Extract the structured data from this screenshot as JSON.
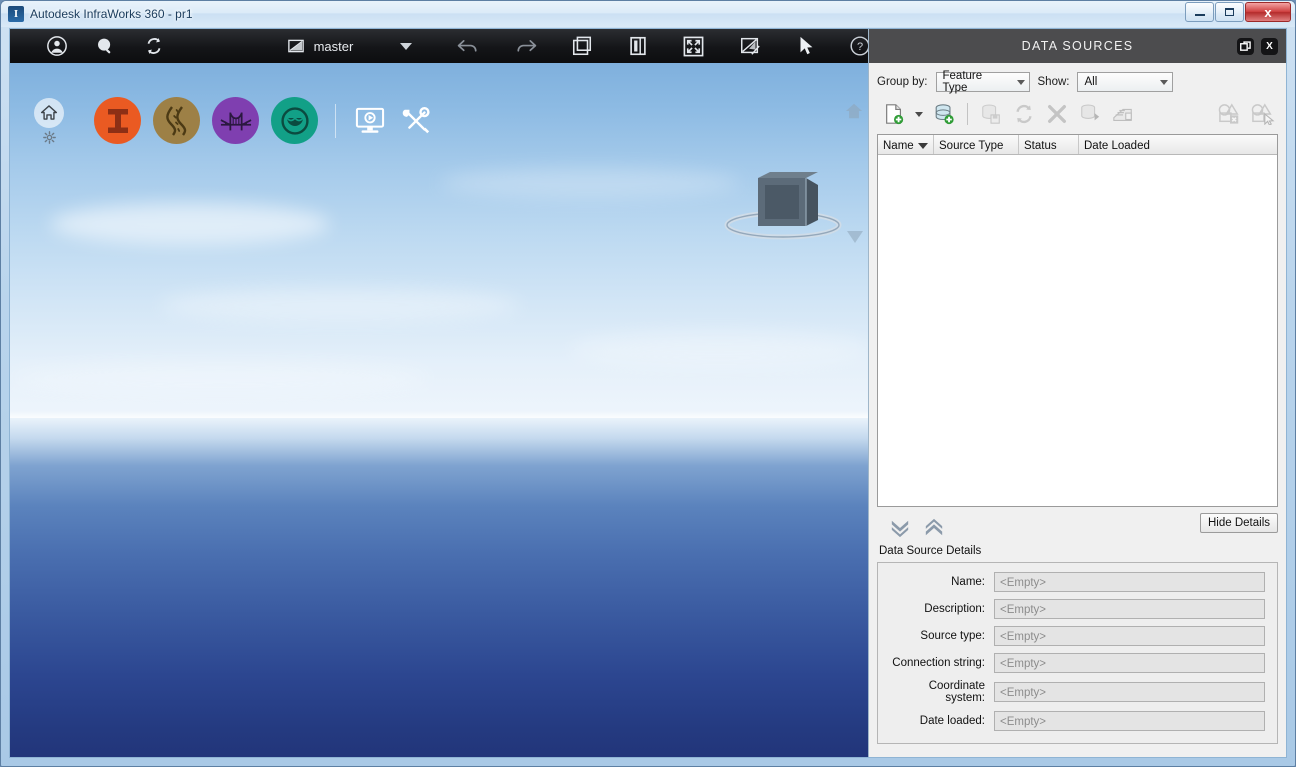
{
  "window": {
    "title": "Autodesk InfraWorks 360 - pr1",
    "app_icon": "infraworks-logo-icon",
    "buttons": {
      "minimize": "minimize-icon",
      "maximize": "maximize-icon",
      "close": "x"
    }
  },
  "app_toolbar": {
    "items": [
      {
        "name": "account-icon",
        "title": "Account"
      },
      {
        "name": "search-icon",
        "title": "Search"
      },
      {
        "name": "sync-icon",
        "title": "Sync"
      }
    ],
    "model_chip": {
      "icon": "model-icon",
      "label": "master",
      "caret": "chevron-down-icon"
    },
    "right_items": [
      {
        "name": "undo-icon",
        "title": "Undo"
      },
      {
        "name": "redo-icon",
        "title": "Redo"
      },
      {
        "name": "bookmarks-icon",
        "title": "Bookmarks"
      },
      {
        "name": "panels-icon",
        "title": "Panels"
      },
      {
        "name": "fullscreen-icon",
        "title": "Full Screen"
      },
      {
        "name": "measure-icon",
        "title": "Measure"
      },
      {
        "name": "select-cursor-icon",
        "title": "Select"
      },
      {
        "name": "help-icon",
        "title": "Help"
      }
    ]
  },
  "viewport": {
    "home_button": "home-icon",
    "settings_button": "gear-icon",
    "feature_buttons": [
      {
        "name": "intersection-tool",
        "color": "#ea5a22",
        "glyph": "i-beam-icon"
      },
      {
        "name": "road-tool",
        "color": "#9d8046",
        "glyph": "road-icon"
      },
      {
        "name": "bridge-tool",
        "color": "#7f3fb0",
        "glyph": "bridge-icon"
      },
      {
        "name": "water-tool",
        "color": "#12a087",
        "glyph": "water-icon"
      }
    ],
    "flat_buttons": [
      {
        "name": "presentation-icon",
        "title": "Presentation"
      },
      {
        "name": "tools-icon",
        "title": "Tools"
      }
    ],
    "viewcube": "viewcube-navigation-widget",
    "nav_home_small": "home-icon",
    "nav_chevron": "chevron-down-icon"
  },
  "panel": {
    "title": "DATA SOURCES",
    "header_buttons": [
      {
        "name": "undock-panel-button",
        "glyph": "⧉"
      },
      {
        "name": "close-panel-button",
        "glyph": "X"
      }
    ],
    "filters": {
      "group_by_label": "Group by:",
      "group_by_value": "Feature Type",
      "show_label": "Show:",
      "show_value": "All"
    },
    "toolbar": [
      {
        "name": "add-file-data-source-button",
        "enabled": true
      },
      {
        "name": "add-file-dropdown-button",
        "enabled": true
      },
      {
        "name": "connect-database-button",
        "enabled": true
      },
      {
        "name": "save-data-source-button",
        "enabled": false
      },
      {
        "name": "refresh-data-source-button",
        "enabled": false
      },
      {
        "name": "delete-data-source-button",
        "enabled": false
      },
      {
        "name": "import-data-source-button",
        "enabled": false
      },
      {
        "name": "configure-data-source-button",
        "enabled": false
      },
      {
        "name": "close-all-features-button",
        "enabled": false
      },
      {
        "name": "select-all-features-button",
        "enabled": false
      }
    ],
    "grid": {
      "columns": [
        "Name",
        "Source Type",
        "Status",
        "Date Loaded"
      ],
      "rows": []
    },
    "details_controls": {
      "expand_all": "chevrons-down-icon",
      "collapse_all": "chevrons-up-icon",
      "hide_details_label": "Hide Details"
    },
    "details": {
      "title": "Data Source Details",
      "empty_value": "<Empty>",
      "fields": [
        {
          "label": "Name:",
          "value": "<Empty>"
        },
        {
          "label": "Description:",
          "value": "<Empty>"
        },
        {
          "label": "Source type:",
          "value": "<Empty>"
        },
        {
          "label": "Connection string:",
          "value": "<Empty>"
        },
        {
          "label": "Coordinate system:",
          "value": "<Empty>"
        },
        {
          "label": "Date loaded:",
          "value": "<Empty>"
        }
      ]
    }
  }
}
